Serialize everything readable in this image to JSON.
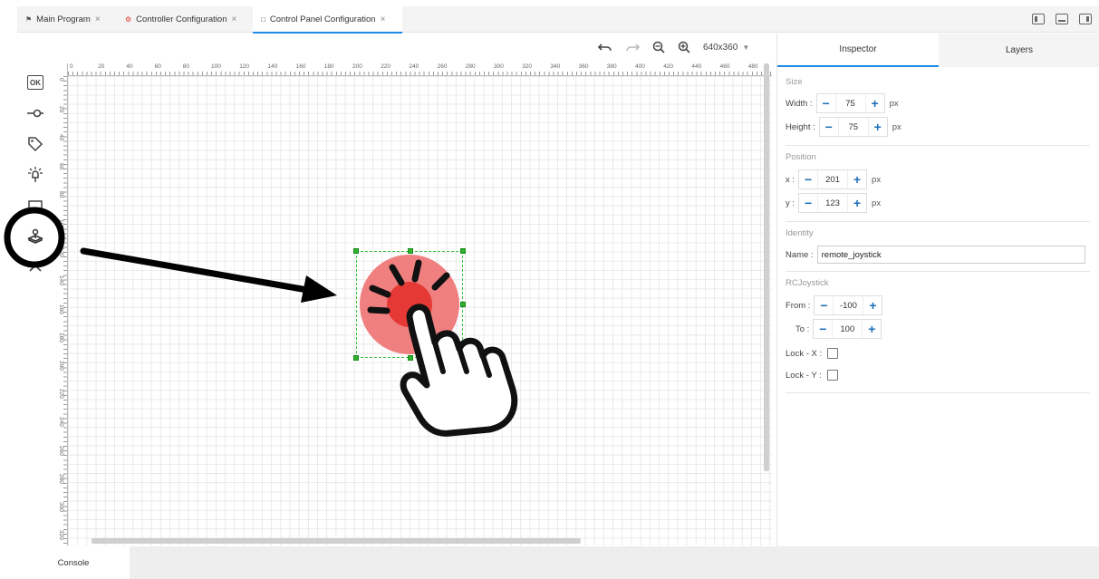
{
  "tabs": [
    {
      "label": "Main Program",
      "icon": "flag-icon"
    },
    {
      "label": "Controller Configuration",
      "icon": "gear-icon"
    },
    {
      "label": "Control Panel Configuration",
      "icon": "page-icon"
    }
  ],
  "close_glyph": "×",
  "canvas_toolbar": {
    "resolution": "640x360"
  },
  "ruler": {
    "top_labels": [
      "0",
      "20",
      "40",
      "60",
      "80",
      "100",
      "120",
      "140",
      "160",
      "180",
      "200",
      "220",
      "240",
      "260",
      "280",
      "300",
      "320",
      "340",
      "360",
      "380",
      "400",
      "420",
      "440",
      "460",
      "480"
    ],
    "left_labels": [
      "0",
      "20",
      "40",
      "60",
      "80",
      "100",
      "120",
      "140",
      "160",
      "180",
      "200",
      "220",
      "240",
      "260",
      "280",
      "300",
      "320",
      "340"
    ]
  },
  "tools": {
    "ok_label": "OK"
  },
  "inspector": {
    "tab_inspector": "Inspector",
    "tab_layers": "Layers",
    "size": {
      "title": "Size",
      "width_label": "Width :",
      "width_value": "75",
      "height_label": "Height :",
      "height_value": "75",
      "unit": "px"
    },
    "position": {
      "title": "Position",
      "x_label": "x :",
      "x_value": "201",
      "y_label": "y :",
      "y_value": "123",
      "unit": "px"
    },
    "identity": {
      "title": "Identity",
      "name_label": "Name :",
      "name_value": "remote_joystick"
    },
    "rcjoystick": {
      "title": "RCJoystick",
      "from_label": "From :",
      "from_value": "-100",
      "to_label": "To :",
      "to_value": "100",
      "lock_x_label": "Lock - X :",
      "lock_y_label": "Lock - Y :"
    }
  },
  "console": {
    "label": "Console"
  },
  "colors": {
    "accent": "#1e88e5",
    "joystick_outer": "#f08080",
    "joystick_inner": "#e53935",
    "selection": "#2fb32f"
  }
}
